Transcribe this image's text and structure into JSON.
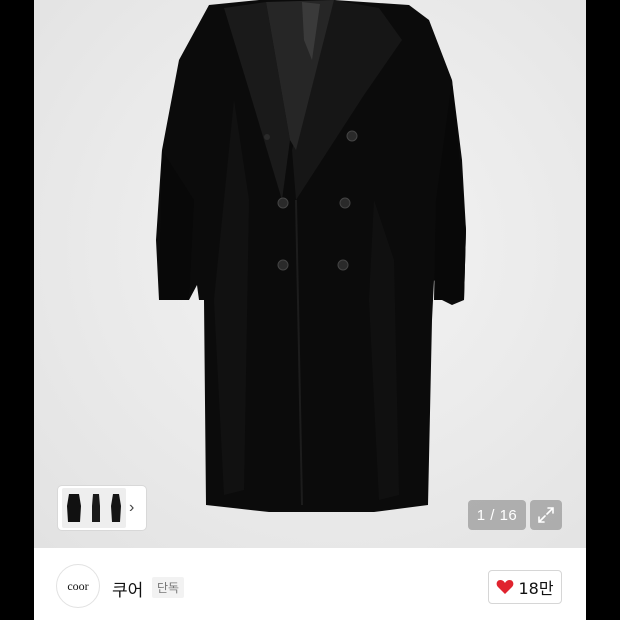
{
  "product_images": {
    "current": "1",
    "total": "16",
    "counter_text": "1 / 16",
    "thumbnail_count": 3
  },
  "brand": {
    "logo_text": "coor",
    "name": "쿠어",
    "badge": "단독"
  },
  "likes": {
    "count": "18만",
    "icon": "heart-icon",
    "color": "#e0232e"
  },
  "icons": {
    "thumbnail_next": "chevron-right-icon",
    "fullscreen": "expand-icon"
  },
  "colors": {
    "coat": "#0b0b0b",
    "background": "#ececec"
  }
}
